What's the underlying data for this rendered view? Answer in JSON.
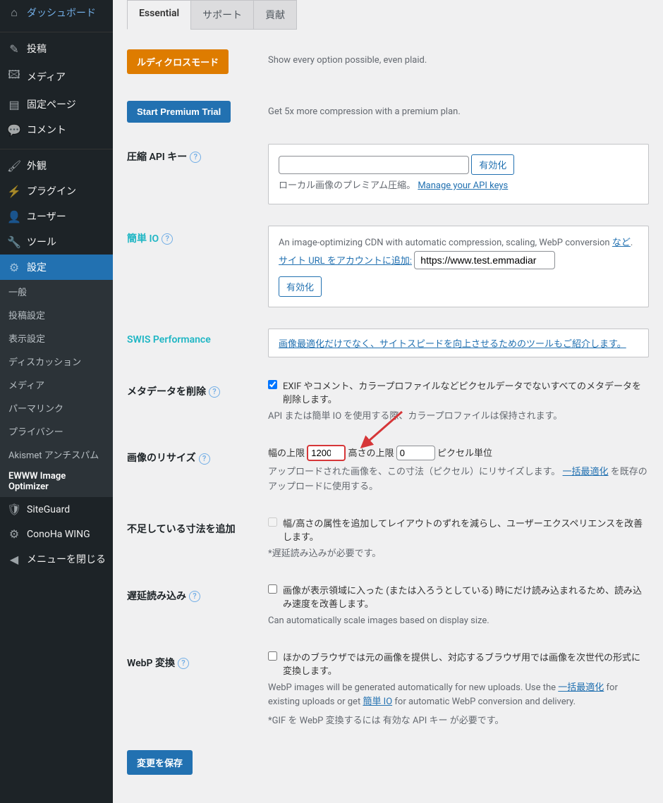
{
  "sidebar": {
    "items": [
      {
        "icon": "⌂",
        "label": "ダッシュボード"
      },
      {
        "sep": true
      },
      {
        "icon": "✎",
        "label": "投稿"
      },
      {
        "icon": "🖾",
        "label": "メディア"
      },
      {
        "icon": "▤",
        "label": "固定ページ"
      },
      {
        "icon": "💬",
        "label": "コメント"
      },
      {
        "sep": true
      },
      {
        "icon": "🖌",
        "label": "外観"
      },
      {
        "icon": "⚡",
        "label": "プラグイン"
      },
      {
        "icon": "👤",
        "label": "ユーザー"
      },
      {
        "icon": "🔧",
        "label": "ツール"
      },
      {
        "icon": "⚙",
        "label": "設定",
        "current": true
      }
    ],
    "sub": [
      "一般",
      "投稿設定",
      "表示設定",
      "ディスカッション",
      "メディア",
      "パーマリンク",
      "プライバシー",
      "Akismet アンチスパム",
      "EWWW Image Optimizer"
    ],
    "sub_active": 8,
    "tail": [
      {
        "icon": "🛡",
        "label": "SiteGuard"
      },
      {
        "icon": "⚙",
        "label": "ConoHa WING"
      },
      {
        "icon": "◀",
        "label": "メニューを閉じる"
      }
    ]
  },
  "tabs": [
    "Essential",
    "サポート",
    "貢献"
  ],
  "ludicrous": {
    "btn": "ルディクロスモード",
    "desc": "Show every option possible, even plaid."
  },
  "premium": {
    "btn": "Start Premium Trial",
    "desc": "Get 5x more compression with a premium plan."
  },
  "api": {
    "label": "圧縮 API キー",
    "activate": "有効化",
    "desc_pre": "ローカル画像のプレミアム圧縮。",
    "link": "Manage your API keys"
  },
  "easyio": {
    "label": "簡単 IO",
    "text1": "An image-optimizing CDN with automatic compression, scaling, WebP conversion",
    "etc": "など",
    "addurl": "サイト URL をアカウントに追加:",
    "url_value": "https://www.test.emmadiar",
    "activate": "有効化"
  },
  "swis": {
    "label": "SWIS Performance",
    "link": "画像最適化だけでなく、サイトスピードを向上させるためのツールもご紹介します。"
  },
  "meta": {
    "label": "メタデータを削除",
    "ck": "EXIF やコメント、カラープロファイルなどピクセルデータでないすべてのメタデータを削除します。",
    "desc": "API または簡単 IO を使用する際、カラープロファイルは保持されます。"
  },
  "resize": {
    "label": "画像のリサイズ",
    "width_label": "幅の上限",
    "width": "1200",
    "height_label": "高さの上限",
    "height": "0",
    "unit": "ピクセル単位",
    "desc_pre": "アップロードされた画像を、この寸法（ピクセル）にリサイズします。",
    "link": "一括最適化",
    "desc_post": "を既存のアップロードに使用する。"
  },
  "dims": {
    "label": "不足している寸法を追加",
    "ck": "幅/高さの属性を追加してレイアウトのずれを減らし、ユーザーエクスペリエンスを改善します。",
    "note": "*遅延読み込みが必要です。"
  },
  "lazy": {
    "label": "遅延読み込み",
    "ck": "画像が表示領域に入った (または入ろうとしている) 時にだけ読み込まれるため、読み込み速度を改善します。",
    "desc": "Can automatically scale images based on display size."
  },
  "webp": {
    "label": "WebP 変換",
    "ck": "ほかのブラウザでは元の画像を提供し、対応するブラウザ用では画像を次世代の形式に変換します。",
    "d1a": "WebP images will be generated automatically for new uploads. Use the ",
    "d1_link1": "一括最適化",
    "d1b": " for existing uploads or get ",
    "d1_link2": "簡単 IO",
    "d1c": " for automatic WebP conversion and delivery.",
    "d2": "*GIF を WebP 変換するには 有効な API キー が必要です。"
  },
  "save": "変更を保存"
}
